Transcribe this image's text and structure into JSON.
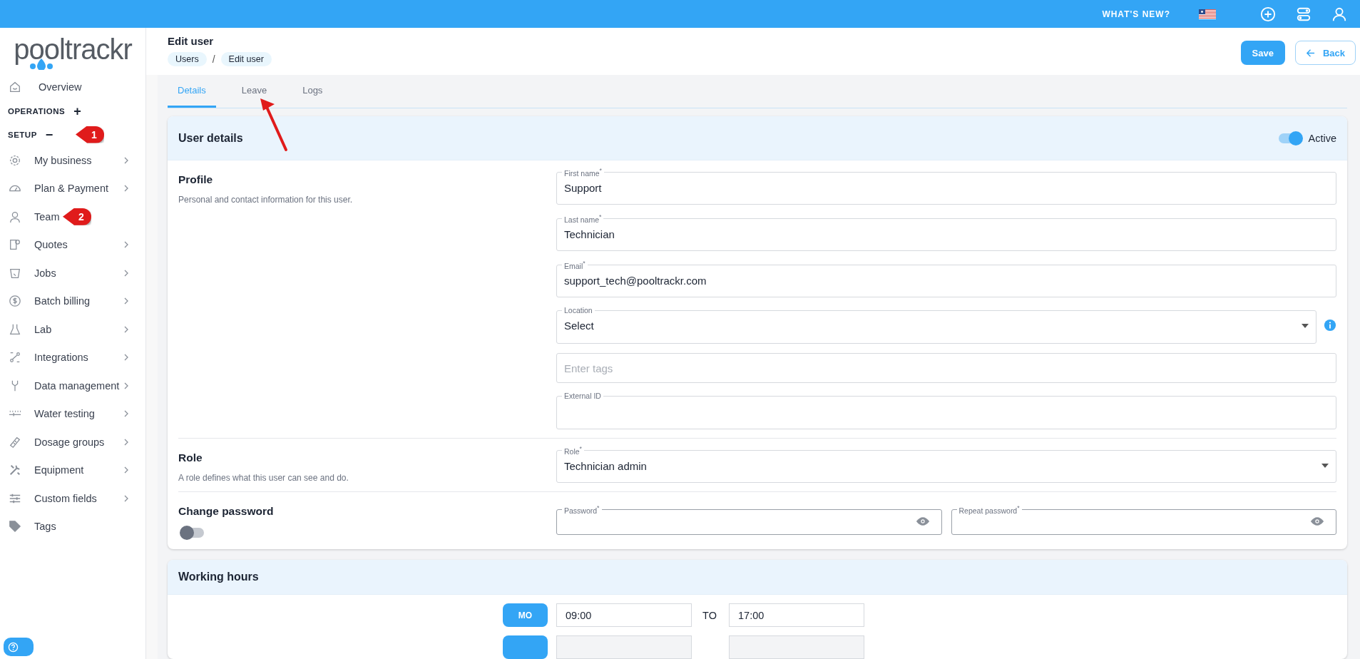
{
  "topbar": {
    "whats_new": "WHAT'S NEW?"
  },
  "logo": "pooltrackr",
  "sidebar": {
    "items": [
      {
        "kind": "link",
        "label": "Overview",
        "chevron": false
      },
      {
        "kind": "section",
        "label": "OPERATIONS",
        "toggle": "+"
      },
      {
        "kind": "section",
        "label": "SETUP",
        "toggle": "−",
        "callout": "1"
      },
      {
        "kind": "link",
        "label": "My business",
        "chevron": true
      },
      {
        "kind": "link",
        "label": "Plan & Payment",
        "chevron": true
      },
      {
        "kind": "link",
        "label": "Team",
        "chevron": false,
        "callout": "2"
      },
      {
        "kind": "link",
        "label": "Quotes",
        "chevron": true
      },
      {
        "kind": "link",
        "label": "Jobs",
        "chevron": true
      },
      {
        "kind": "link",
        "label": "Batch billing",
        "chevron": true
      },
      {
        "kind": "link",
        "label": "Lab",
        "chevron": true
      },
      {
        "kind": "link",
        "label": "Integrations",
        "chevron": true
      },
      {
        "kind": "link",
        "label": "Data management",
        "chevron": true
      },
      {
        "kind": "link",
        "label": "Water testing",
        "chevron": true
      },
      {
        "kind": "link",
        "label": "Dosage groups",
        "chevron": true
      },
      {
        "kind": "link",
        "label": "Equipment",
        "chevron": true
      },
      {
        "kind": "link",
        "label": "Custom fields",
        "chevron": true
      },
      {
        "kind": "link",
        "label": "Tags",
        "chevron": false
      }
    ]
  },
  "page": {
    "title": "Edit user",
    "breadcrumbs": [
      "Users",
      "Edit user"
    ],
    "separator": "/",
    "save": "Save",
    "back": "Back"
  },
  "tabs": [
    {
      "label": "Details",
      "selected": true
    },
    {
      "label": "Leave",
      "selected": false
    },
    {
      "label": "Logs",
      "selected": false
    }
  ],
  "user_details": {
    "title": "User details",
    "active": {
      "label": "Active",
      "on": true
    },
    "sections": [
      {
        "title": "Profile",
        "description": "Personal and contact information for this user.",
        "fields": [
          {
            "kind": "text",
            "label": "First name$^{*}$",
            "value": "Support"
          },
          {
            "kind": "text",
            "label": "Last name$^{*}$",
            "value": "Technician"
          },
          {
            "kind": "text",
            "label": "Email$^{*}$",
            "value": "support_tech@pooltrackr.com"
          },
          {
            "kind": "select",
            "label": "Location",
            "value": "Select",
            "info": true
          },
          {
            "kind": "tags",
            "placeholder": "Enter tags"
          },
          {
            "kind": "text",
            "label": "External ID"
          }
        ]
      },
      {
        "title": "Role",
        "description": "A role defines what this user can see and do.",
        "fields": [
          {
            "kind": "select",
            "label": "Role$^{*}$",
            "value": "Technician admin",
            "info": false
          }
        ]
      },
      {
        "title": "Change password",
        "toggle_on": false,
        "fields": [
          {
            "kind": "password",
            "label": "Password$^{*}$"
          },
          {
            "kind": "password",
            "label": "Repeat password$^{*}$"
          }
        ]
      }
    ]
  },
  "working_hours": {
    "title": "Working hours",
    "rows": [
      {
        "day": "MO",
        "from": "09:00",
        "separator": "TO",
        "to": "17:00"
      },
      {
        "kind": "partial"
      }
    ]
  }
}
